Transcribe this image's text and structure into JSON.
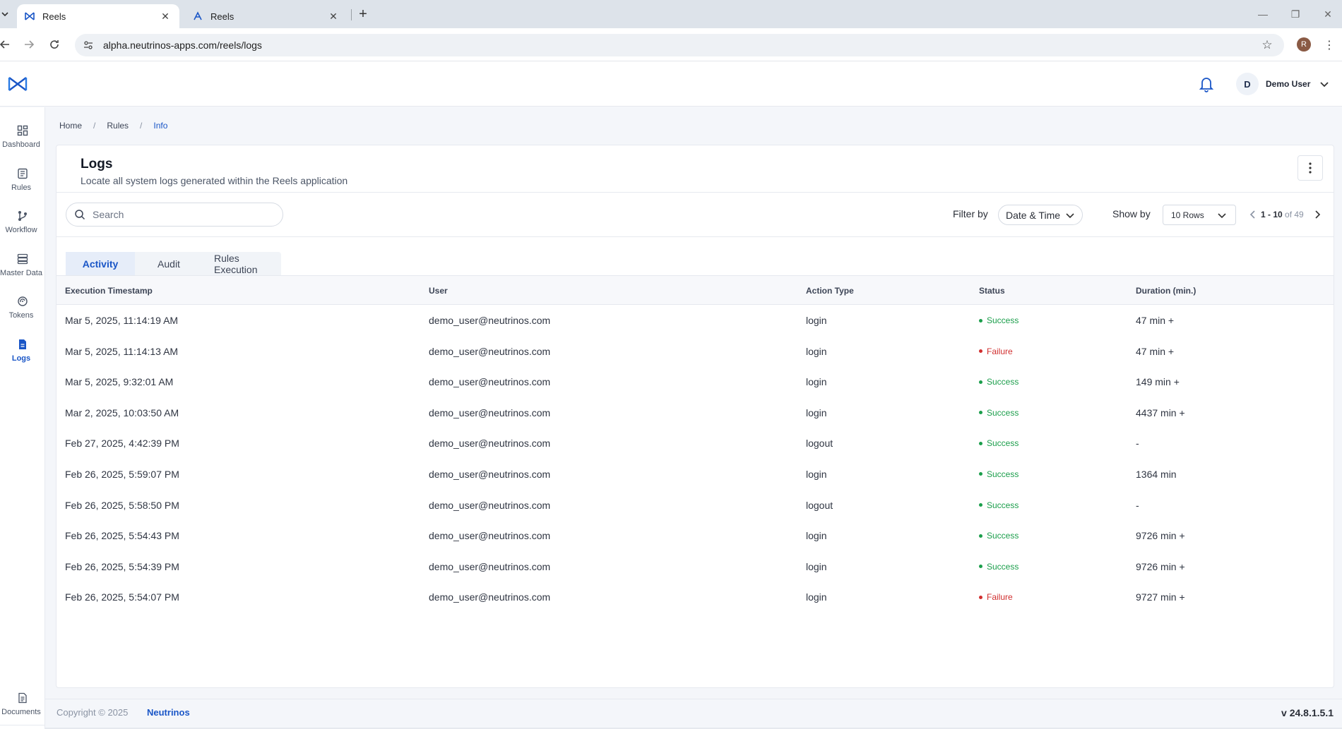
{
  "browser": {
    "tabs": [
      {
        "title": "Reels",
        "active": true
      },
      {
        "title": "Reels",
        "active": false
      }
    ],
    "url": "alpha.neutrinos-apps.com/reels/logs",
    "profile_initial": "R"
  },
  "header": {
    "user_initial": "D",
    "user_name": "Demo User"
  },
  "sidebar": {
    "items": [
      {
        "label": "Dashboard",
        "icon": "dashboard-icon"
      },
      {
        "label": "Rules",
        "icon": "rules-icon"
      },
      {
        "label": "Workflow",
        "icon": "workflow-icon"
      },
      {
        "label": "Master Data",
        "icon": "master-data-icon"
      },
      {
        "label": "Tokens",
        "icon": "tokens-icon"
      },
      {
        "label": "Logs",
        "icon": "logs-icon",
        "active": true
      },
      {
        "label": "Documents",
        "icon": "documents-icon"
      }
    ]
  },
  "breadcrumb": {
    "home": "Home",
    "rules": "Rules",
    "current": "Info",
    "separator": "/"
  },
  "page": {
    "title": "Logs",
    "subtitle": "Locate all system logs generated within the Reels application"
  },
  "toolbar": {
    "search_placeholder": "Search",
    "filter_label": "Filter by",
    "filter_value": "Date & Time",
    "show_label": "Show by",
    "show_value": "10 Rows",
    "pager_range": "1 - 10",
    "pager_of": "of 49"
  },
  "tabs": {
    "activity": "Activity",
    "audit": "Audit",
    "rules_execution": "Rules Execution"
  },
  "table": {
    "columns": [
      "Execution Timestamp",
      "User",
      "Action Type",
      "Status",
      "Duration (min.)"
    ],
    "rows": [
      {
        "timestamp": "Mar 5, 2025, 11:14:19 AM",
        "user": "demo_user@neutrinos.com",
        "action": "login",
        "status": "Success",
        "duration": "47 min +"
      },
      {
        "timestamp": "Mar 5, 2025, 11:14:13 AM",
        "user": "demo_user@neutrinos.com",
        "action": "login",
        "status": "Failure",
        "duration": "47 min +"
      },
      {
        "timestamp": "Mar 5, 2025, 9:32:01 AM",
        "user": "demo_user@neutrinos.com",
        "action": "login",
        "status": "Success",
        "duration": "149 min +"
      },
      {
        "timestamp": "Mar 2, 2025, 10:03:50 AM",
        "user": "demo_user@neutrinos.com",
        "action": "login",
        "status": "Success",
        "duration": "4437 min +"
      },
      {
        "timestamp": "Feb 27, 2025, 4:42:39 PM",
        "user": "demo_user@neutrinos.com",
        "action": "logout",
        "status": "Success",
        "duration": "-"
      },
      {
        "timestamp": "Feb 26, 2025, 5:59:07 PM",
        "user": "demo_user@neutrinos.com",
        "action": "login",
        "status": "Success",
        "duration": "1364 min"
      },
      {
        "timestamp": "Feb 26, 2025, 5:58:50 PM",
        "user": "demo_user@neutrinos.com",
        "action": "logout",
        "status": "Success",
        "duration": "-"
      },
      {
        "timestamp": "Feb 26, 2025, 5:54:43 PM",
        "user": "demo_user@neutrinos.com",
        "action": "login",
        "status": "Success",
        "duration": "9726 min +"
      },
      {
        "timestamp": "Feb 26, 2025, 5:54:39 PM",
        "user": "demo_user@neutrinos.com",
        "action": "login",
        "status": "Success",
        "duration": "9726 min +"
      },
      {
        "timestamp": "Feb 26, 2025, 5:54:07 PM",
        "user": "demo_user@neutrinos.com",
        "action": "login",
        "status": "Failure",
        "duration": "9727 min +"
      }
    ]
  },
  "footer": {
    "copyright": "Copyright © 2025",
    "brand": "Neutrinos",
    "version": "v 24.8.1.5.1"
  },
  "colors": {
    "accent": "#1a56c7",
    "success": "#1b9e4b",
    "failure": "#d12f2f"
  }
}
